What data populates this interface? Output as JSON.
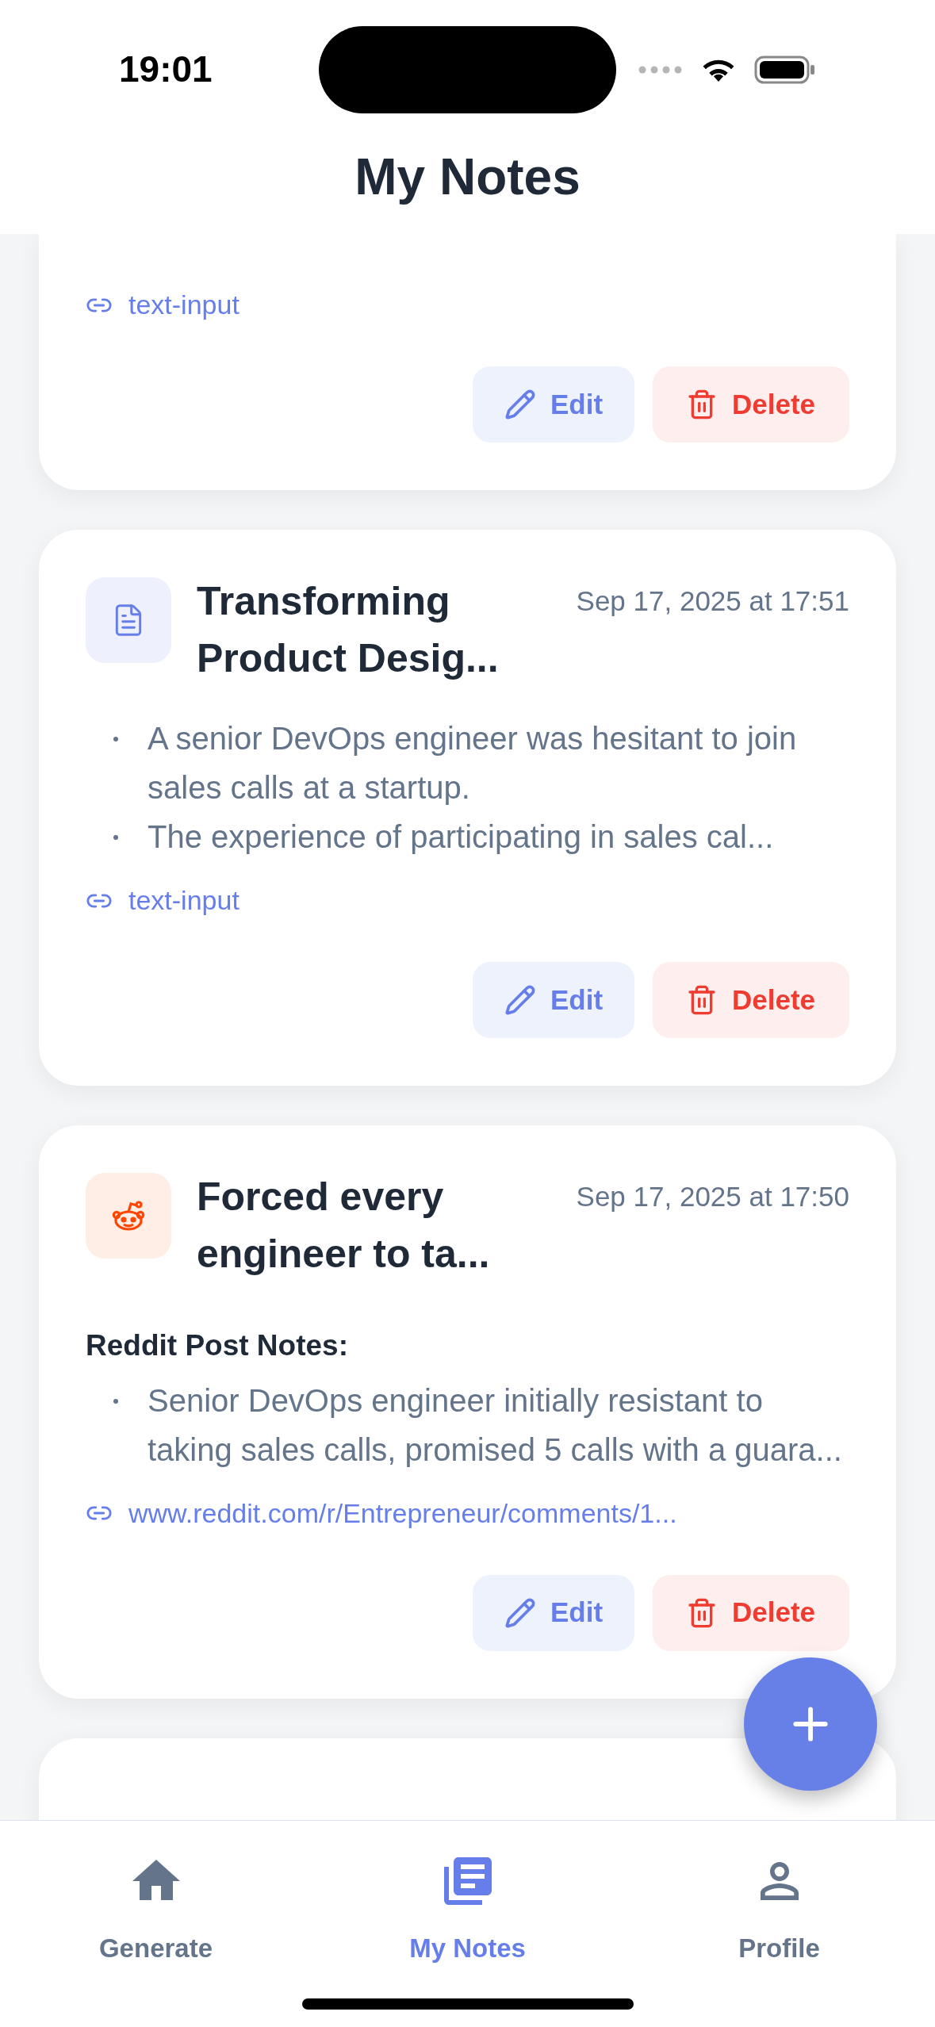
{
  "status_bar": {
    "time": "19:01"
  },
  "header": {
    "title": "My Notes"
  },
  "notes": [
    {
      "kind": "partial",
      "link": "text-input",
      "actions": [
        "Edit",
        "Delete"
      ]
    },
    {
      "kind": "document",
      "title": "Transforming Product Desig...",
      "date": "Sep 17, 2025 at 17:51",
      "bullets": [
        "A senior DevOps engineer was hesitant to join sales calls at a startup.",
        "The experience of participating in sales cal..."
      ],
      "link": "text-input",
      "actions": [
        "Edit",
        "Delete"
      ]
    },
    {
      "kind": "reddit",
      "title": "Forced every engineer to ta...",
      "date": "Sep 17, 2025 at 17:50",
      "heading": "Reddit Post Notes:",
      "bullets": [
        "Senior DevOps engineer initially resistant to taking sales calls, promised 5 calls with a guara..."
      ],
      "link": "www.reddit.com/r/Entrepreneur/comments/1...",
      "actions": [
        "Edit",
        "Delete"
      ]
    },
    {
      "kind": "empty"
    }
  ],
  "tabs": [
    {
      "label": "Generate",
      "kind": "home",
      "selected": false
    },
    {
      "label": "My Notes",
      "kind": "notes",
      "selected": true
    },
    {
      "label": "Profile",
      "kind": "person",
      "selected": false
    }
  ]
}
